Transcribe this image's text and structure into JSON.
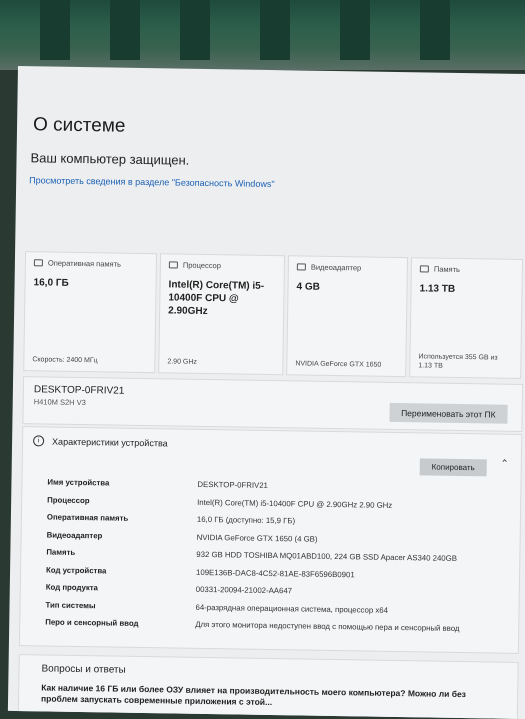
{
  "page": {
    "title": "О системе",
    "protected": "Ваш компьютер защищен.",
    "security_link": "Просмотреть сведения в разделе \"Безопасность Windows\""
  },
  "cards": [
    {
      "icon": "ram-icon",
      "label": "Оперативная память",
      "value": "16,0 ГБ",
      "footer": "Скорость: 2400 МГц"
    },
    {
      "icon": "processor-icon",
      "label": "Процессор",
      "value": "Intel(R) Core(TM) i5-10400F CPU @ 2.90GHz",
      "footer": "2.90 GHz"
    },
    {
      "icon": "gpu-icon",
      "label": "Видеоадаптер",
      "value": "4 GB",
      "footer": "NVIDIA GeForce GTX 1650"
    },
    {
      "icon": "storage-icon",
      "label": "Память",
      "value": "1.13 TB",
      "footer": "Используется 355 GB из 1.13 TB"
    }
  ],
  "device": {
    "name": "DESKTOP-0FRIV21",
    "board": "H410M S2H V3",
    "rename_label": "Переименовать этот ПК"
  },
  "specs": {
    "header": "Характеристики устройства",
    "copy_label": "Копировать",
    "rows": [
      {
        "label": "Имя устройства",
        "value": "DESKTOP-0FRIV21"
      },
      {
        "label": "Процессор",
        "value": "Intel(R) Core(TM) i5-10400F CPU @ 2.90GHz   2.90 GHz"
      },
      {
        "label": "Оперативная память",
        "value": "16,0 ГБ (доступно: 15,9 ГБ)"
      },
      {
        "label": "Видеоадаптер",
        "value": "NVIDIA GeForce GTX 1650 (4 GB)"
      },
      {
        "label": "Память",
        "value": "932 GB HDD TOSHIBA MQ01ABD100, 224 GB SSD Apacer AS340 240GB"
      },
      {
        "label": "Код устройства",
        "value": "109E136B-DAC8-4C52-81AE-83F6596B0901"
      },
      {
        "label": "Код продукта",
        "value": "00331-20094-21002-AA647"
      },
      {
        "label": "Тип системы",
        "value": "64-разрядная операционная система, процессор x64"
      },
      {
        "label": "Перо и сенсорный ввод",
        "value": "Для этого монитора недоступен ввод с помощью пера и сенсорный ввод"
      }
    ]
  },
  "faq": {
    "title": "Вопросы и ответы",
    "question": "Как наличие 16 ГБ или более ОЗУ влияет на производительность моего компьютера? Можно ли без проблем запускать современные приложения с этой..."
  }
}
